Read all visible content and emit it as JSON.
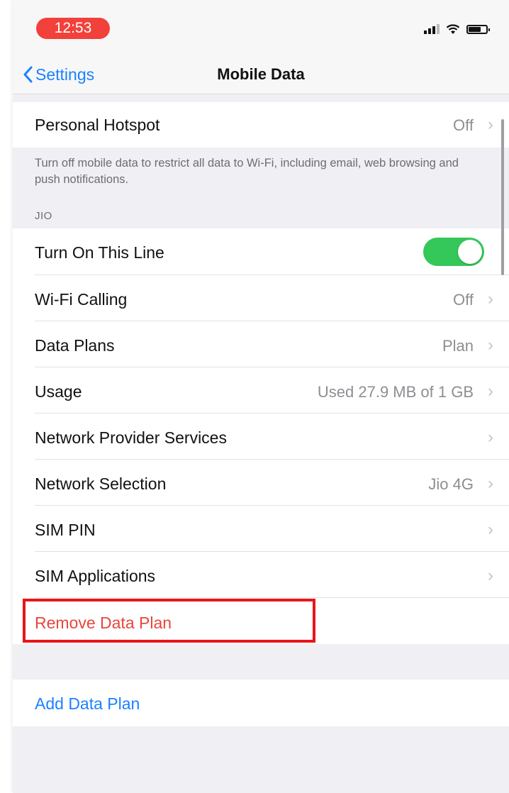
{
  "status_bar": {
    "time": "12:53",
    "icons": [
      "signal-icon",
      "wifi-icon",
      "battery-icon"
    ]
  },
  "nav": {
    "back_label": "Settings",
    "title": "Mobile Data"
  },
  "hotspot": {
    "label": "Personal Hotspot",
    "value": "Off"
  },
  "footer_note": "Turn off mobile data to restrict all data to Wi-Fi, including email, web browsing and push notifications.",
  "section_header": "JIO",
  "rows": {
    "turn_on_line": {
      "label": "Turn On This Line",
      "toggle_on": true
    },
    "wifi_calling": {
      "label": "Wi-Fi Calling",
      "value": "Off"
    },
    "data_plans": {
      "label": "Data Plans",
      "value": "Plan"
    },
    "usage": {
      "label": "Usage",
      "value": "Used 27.9 MB of 1 GB"
    },
    "network_provider": {
      "label": "Network Provider Services",
      "value": ""
    },
    "network_selection": {
      "label": "Network Selection",
      "value": "Jio 4G"
    },
    "sim_pin": {
      "label": "SIM PIN",
      "value": ""
    },
    "sim_applications": {
      "label": "SIM Applications",
      "value": ""
    }
  },
  "remove_data_plan": "Remove Data Plan",
  "add_data_plan": "Add Data Plan",
  "colors": {
    "accent": "#1a82ff",
    "destructive": "#e8453c",
    "toggle_on": "#34c759",
    "highlight_box": "#e8151b",
    "time_pill": "#f2413a"
  }
}
